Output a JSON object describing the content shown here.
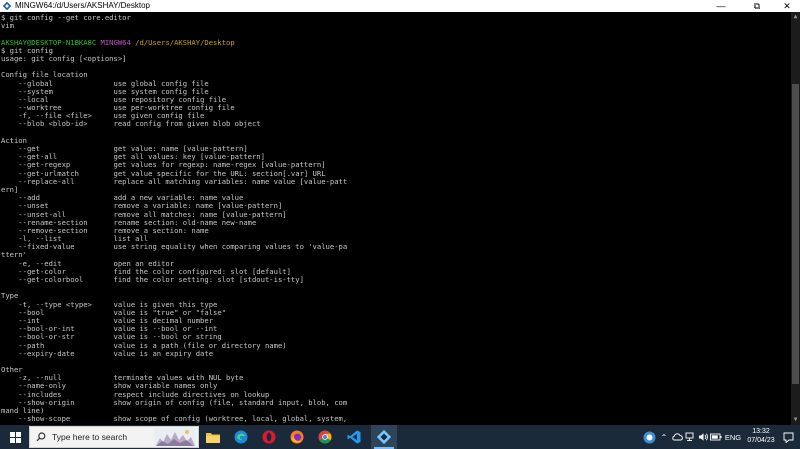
{
  "window": {
    "title": "MINGW64:/d/Users/AKSHAY/Desktop",
    "minimize_glyph": "—",
    "maximize_glyph": "⧉",
    "close_glyph": "✕"
  },
  "prompt": {
    "user_host": "AKSHAY@DESKTOP-N1BKA8C",
    "shell": "MINGW64",
    "path": "/d/Users/AKSHAY/Desktop"
  },
  "terminal_lines": [
    "$ git config --get core.editor",
    "vim",
    "",
    "__PROMPT__",
    "$ git config",
    "usage: git config [<options>]",
    "",
    "Config file location",
    "    --global              use global config file",
    "    --system              use system config file",
    "    --local               use repository config file",
    "    --worktree            use per-worktree config file",
    "    -f, --file <file>     use given config file",
    "    --blob <blob-id>      read config from given blob object",
    "",
    "Action",
    "    --get                 get value: name [value-pattern]",
    "    --get-all             get all values: key [value-pattern]",
    "    --get-regexp          get values for regexp: name-regex [value-pattern]",
    "    --get-urlmatch        get value specific for the URL: section[.var] URL",
    "    --replace-all         replace all matching variables: name value [value-patt",
    "ern]",
    "    --add                 add a new variable: name value",
    "    --unset               remove a variable: name [value-pattern]",
    "    --unset-all           remove all matches: name [value-pattern]",
    "    --rename-section      rename section: old-name new-name",
    "    --remove-section      remove a section: name",
    "    -l, --list            list all",
    "    --fixed-value         use string equality when comparing values to 'value-pa",
    "ttern'",
    "    -e, --edit            open an editor",
    "    --get-color           find the color configured: slot [default]",
    "    --get-colorbool       find the color setting: slot [stdout-is-tty]",
    "",
    "Type",
    "    -t, --type <type>     value is given this type",
    "    --bool                value is \"true\" or \"false\"",
    "    --int                 value is decimal number",
    "    --bool-or-int         value is --bool or --int",
    "    --bool-or-str         value is --bool or string",
    "    --path                value is a path (file or directory name)",
    "    --expiry-date         value is an expiry date",
    "",
    "Other",
    "    -z, --null            terminate values with NUL byte",
    "    --name-only           show variable names only",
    "    --includes            respect include directives on lookup",
    "    --show-origin         show origin of config (file, standard input, blob, com",
    "mand line)",
    "    --show-scope          show scope of config (worktree, local, global, system,"
  ],
  "taskbar": {
    "search_placeholder": "Type here to search",
    "apps": [
      "file-explorer",
      "edge",
      "opera",
      "firefox",
      "chrome",
      "vscode",
      "git-bash"
    ],
    "active_app": "git-bash",
    "tray": {
      "language": "ENG",
      "time": "13:32",
      "date": "07/04/23"
    }
  },
  "colors": {
    "terminal_bg": "#000000",
    "terminal_fg": "#c8c8c8",
    "prompt_user": "#26c026",
    "prompt_shell": "#c050c0",
    "prompt_path": "#c8a400",
    "taskbar_bg": "#1b2a3a"
  }
}
